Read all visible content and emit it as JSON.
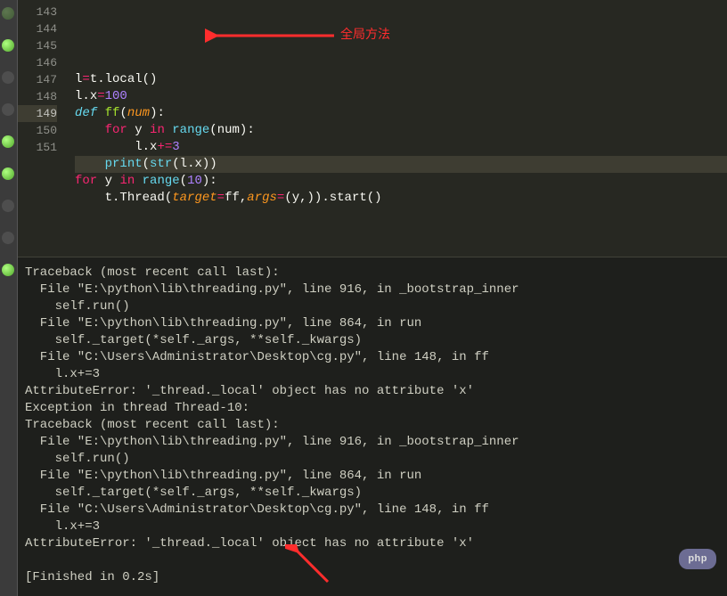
{
  "editor": {
    "line_numbers": [
      "143",
      "144",
      "145",
      "146",
      "147",
      "148",
      "149",
      "150",
      "151"
    ],
    "highlighted_line": "149",
    "tokens": {
      "l144": [
        [
          "plain",
          "l"
        ],
        [
          "op",
          "="
        ],
        [
          "plain",
          "t"
        ],
        [
          "dot",
          "."
        ],
        [
          "plain",
          "local"
        ],
        [
          "paren",
          "()"
        ]
      ],
      "l145": [
        [
          "plain",
          "l"
        ],
        [
          "dot",
          "."
        ],
        [
          "plain",
          "x"
        ],
        [
          "op",
          "="
        ],
        [
          "num",
          "100"
        ]
      ],
      "l146": [
        [
          "def",
          "def"
        ],
        [
          "plain",
          " "
        ],
        [
          "name",
          "ff"
        ],
        [
          "paren",
          "("
        ],
        [
          "param",
          "num"
        ],
        [
          "paren",
          ")"
        ],
        [
          "plain",
          ":"
        ]
      ],
      "l147": [
        [
          "plain",
          "    "
        ],
        [
          "key",
          "for"
        ],
        [
          "plain",
          " y "
        ],
        [
          "key",
          "in"
        ],
        [
          "plain",
          " "
        ],
        [
          "builtin",
          "range"
        ],
        [
          "paren",
          "("
        ],
        [
          "plain",
          "num"
        ],
        [
          "paren",
          ")"
        ],
        [
          "plain",
          ":"
        ]
      ],
      "l148": [
        [
          "plain",
          "        l"
        ],
        [
          "dot",
          "."
        ],
        [
          "plain",
          "x"
        ],
        [
          "op",
          "+="
        ],
        [
          "num",
          "3"
        ]
      ],
      "l149": [
        [
          "plain",
          "    "
        ],
        [
          "builtin",
          "print"
        ],
        [
          "paren",
          "("
        ],
        [
          "builtin",
          "str"
        ],
        [
          "paren",
          "("
        ],
        [
          "plain",
          "l"
        ],
        [
          "dot",
          "."
        ],
        [
          "plain",
          "x"
        ],
        [
          "paren",
          "))"
        ]
      ],
      "l150": [
        [
          "key",
          "for"
        ],
        [
          "plain",
          " y "
        ],
        [
          "key",
          "in"
        ],
        [
          "plain",
          " "
        ],
        [
          "builtin",
          "range"
        ],
        [
          "paren",
          "("
        ],
        [
          "num",
          "10"
        ],
        [
          "paren",
          ")"
        ],
        [
          "plain",
          ":"
        ]
      ],
      "l151": [
        [
          "plain",
          "    t"
        ],
        [
          "dot",
          "."
        ],
        [
          "plain",
          "Thread"
        ],
        [
          "paren",
          "("
        ],
        [
          "param",
          "target"
        ],
        [
          "op",
          "="
        ],
        [
          "plain",
          "ff"
        ],
        [
          "plain",
          ","
        ],
        [
          "param",
          "args"
        ],
        [
          "op",
          "="
        ],
        [
          "paren",
          "("
        ],
        [
          "plain",
          "y"
        ],
        [
          "plain",
          ","
        ],
        [
          "paren",
          "))"
        ],
        [
          "dot",
          "."
        ],
        [
          "plain",
          "start"
        ],
        [
          "paren",
          "()"
        ]
      ]
    },
    "annotation_text": "全局方法"
  },
  "console": {
    "lines": [
      "Traceback (most recent call last):",
      "  File \"E:\\python\\lib\\threading.py\", line 916, in _bootstrap_inner",
      "    self.run()",
      "  File \"E:\\python\\lib\\threading.py\", line 864, in run",
      "    self._target(*self._args, **self._kwargs)",
      "  File \"C:\\Users\\Administrator\\Desktop\\cg.py\", line 148, in ff",
      "    l.x+=3",
      "AttributeError: '_thread._local' object has no attribute 'x'",
      "Exception in thread Thread-10:",
      "Traceback (most recent call last):",
      "  File \"E:\\python\\lib\\threading.py\", line 916, in _bootstrap_inner",
      "    self.run()",
      "  File \"E:\\python\\lib\\threading.py\", line 864, in run",
      "    self._target(*self._args, **self._kwargs)",
      "  File \"C:\\Users\\Administrator\\Desktop\\cg.py\", line 148, in ff",
      "    l.x+=3",
      "AttributeError: '_thread._local' object has no attribute 'x'",
      "",
      "[Finished in 0.2s]"
    ]
  },
  "watermark": "php"
}
